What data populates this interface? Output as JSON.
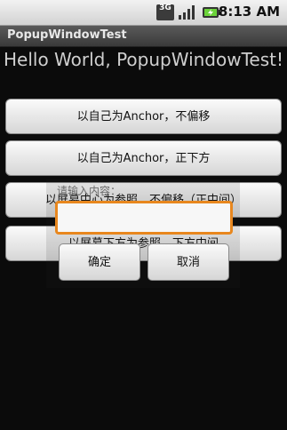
{
  "status_bar": {
    "network_label": "3G",
    "signal_icon": "signal-bars-icon",
    "battery_icon": "battery-charging-icon",
    "time": "8:13 AM"
  },
  "app": {
    "title": "PopupWindowTest"
  },
  "main": {
    "hello_text": "Hello World, PopupWindowTest!",
    "buttons": [
      {
        "label": "以自己为Anchor，不偏移"
      },
      {
        "label": "以自己为Anchor，正下方"
      },
      {
        "label": "以屏幕中心为参照，不偏移（正中间）"
      },
      {
        "label": "以屏幕下方为参照，下方中间"
      }
    ]
  },
  "popup": {
    "prompt": "请输入内容：",
    "input_value": "",
    "confirm_label": "确定",
    "cancel_label": "取消"
  },
  "colors": {
    "background": "#0b0b0b",
    "input_focus_border": "#e8871e"
  }
}
